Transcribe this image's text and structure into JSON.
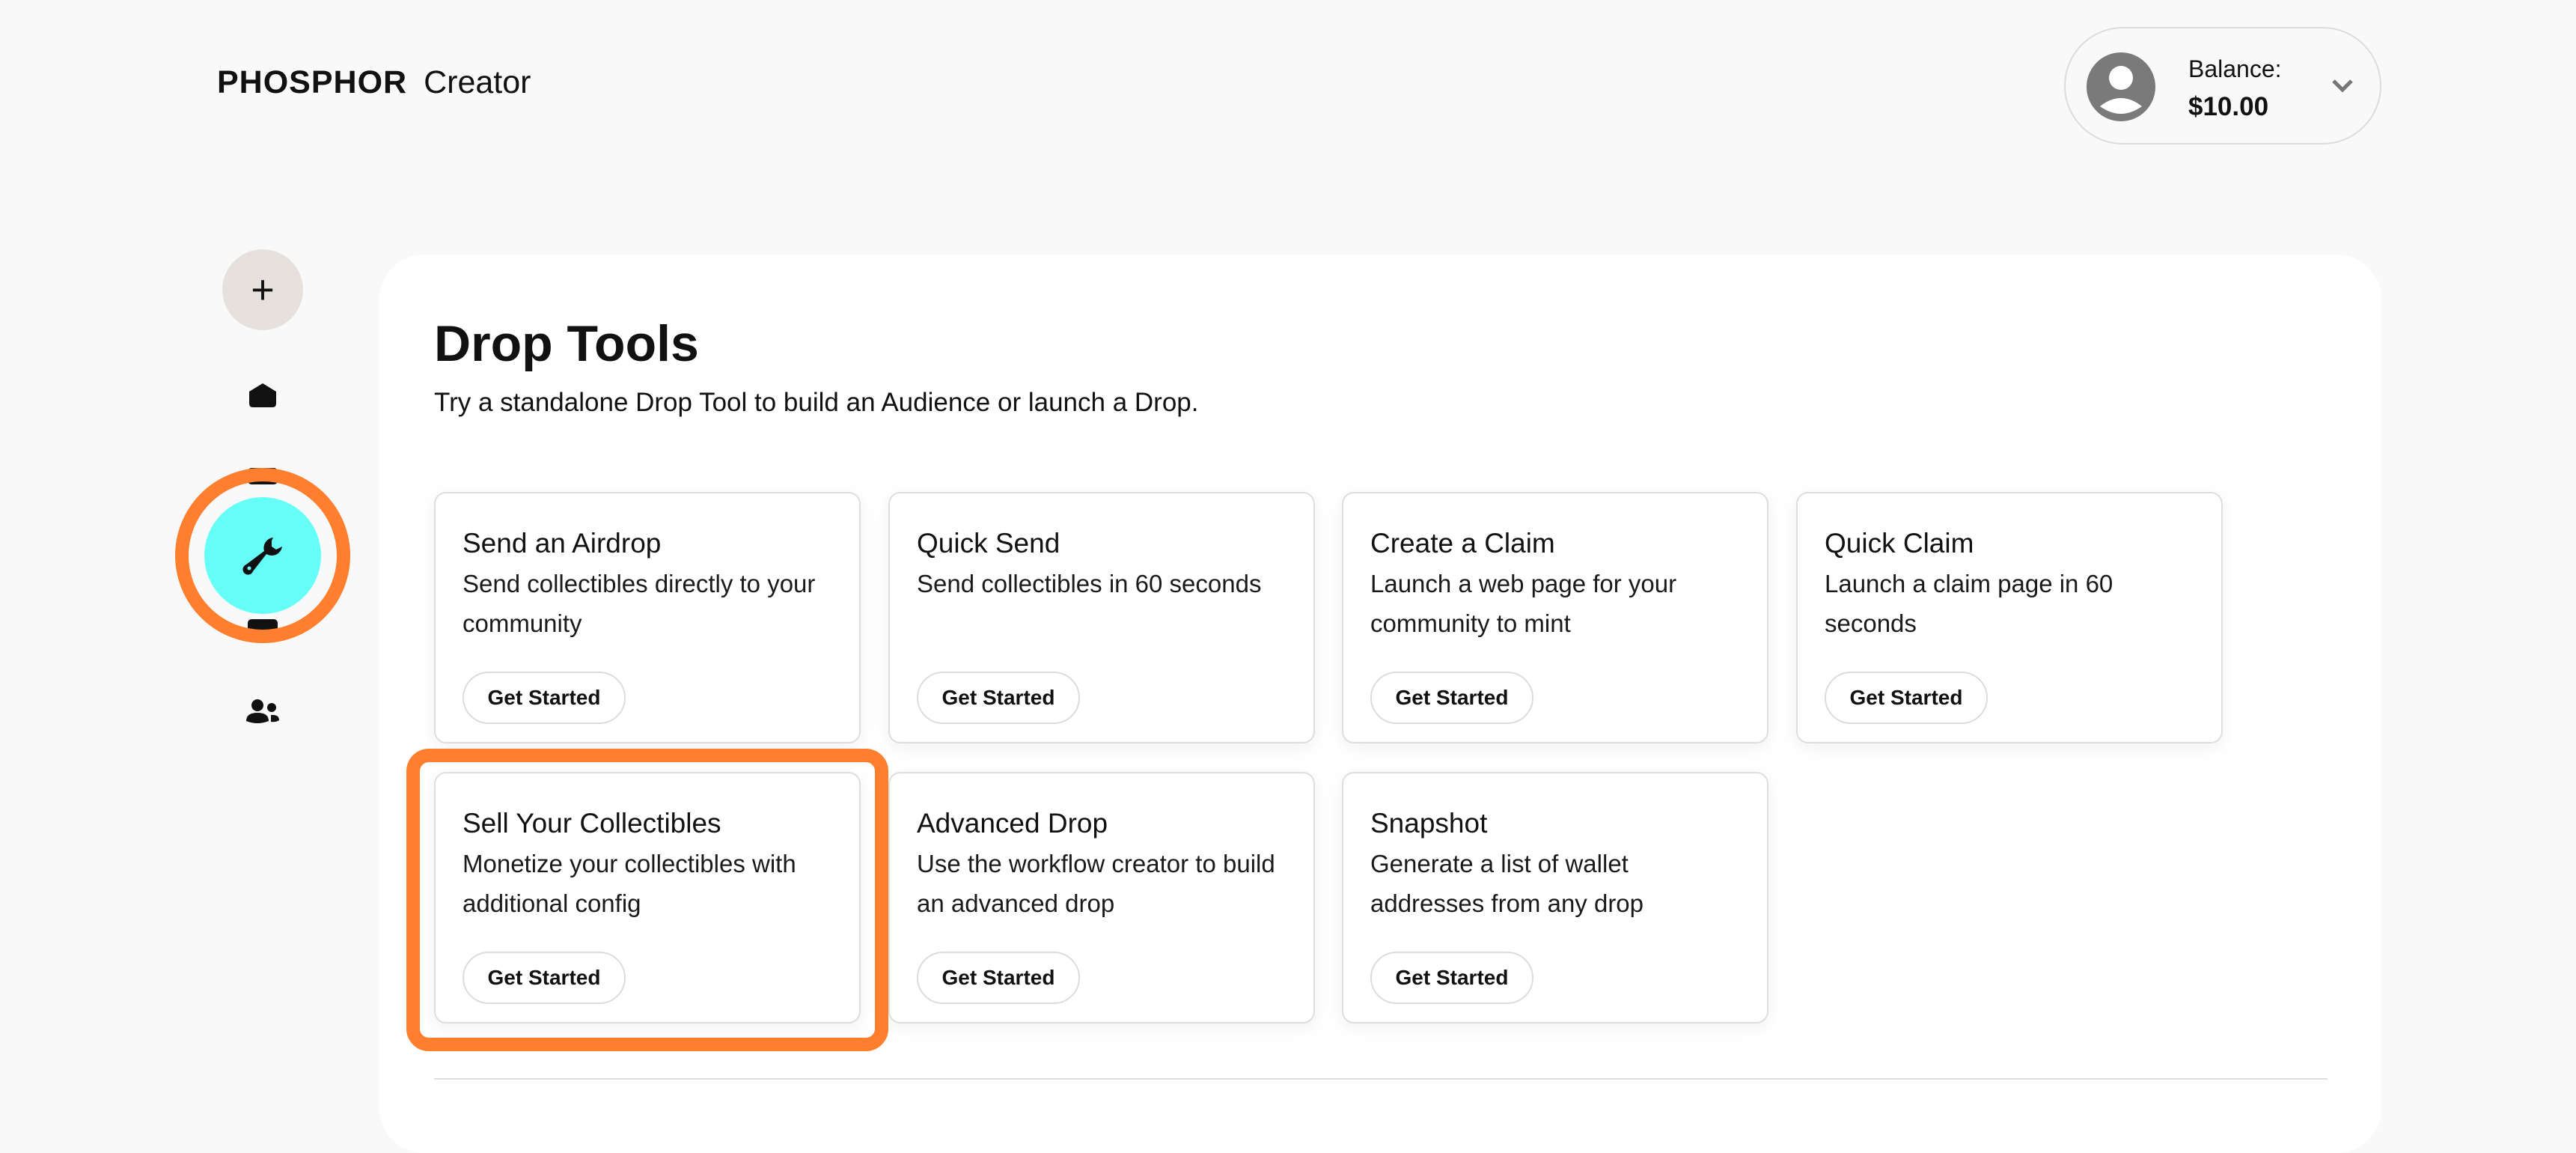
{
  "header": {
    "brand": "PHOSPHOR",
    "product": "Creator",
    "balance_label": "Balance:",
    "balance_value": "$10.00"
  },
  "sidebar": {
    "items": [
      {
        "icon": "plus-icon"
      },
      {
        "icon": "home-icon"
      },
      {
        "icon": "folder-icon"
      },
      {
        "icon": "wrench-icon",
        "active": true
      },
      {
        "icon": "folder-icon"
      },
      {
        "icon": "users-icon"
      }
    ]
  },
  "main": {
    "title": "Drop Tools",
    "subtitle": "Try a standalone Drop Tool to build an Audience or launch a Drop.",
    "cards": [
      {
        "title": "Send an Airdrop",
        "description": "Send collectibles directly to your community",
        "button": "Get Started"
      },
      {
        "title": "Quick Send",
        "description": "Send collectibles in 60 seconds",
        "button": "Get Started"
      },
      {
        "title": "Create a Claim",
        "description": "Launch a web page for your community to mint",
        "button": "Get Started"
      },
      {
        "title": "Quick Claim",
        "description": "Launch a claim page in 60 seconds",
        "button": "Get Started"
      },
      {
        "title": "Sell Your Collectibles",
        "description": "Monetize your collectibles with additional config",
        "button": "Get Started"
      },
      {
        "title": "Advanced Drop",
        "description": "Use the workflow creator to build an advanced drop",
        "button": "Get Started"
      },
      {
        "title": "Snapshot",
        "description": "Generate a list of wallet addresses from any drop",
        "button": "Get Started"
      }
    ]
  },
  "colors": {
    "accent_active": "#66fff8",
    "highlight": "#ff7f2e",
    "plus_bg": "#e6e1dc"
  }
}
